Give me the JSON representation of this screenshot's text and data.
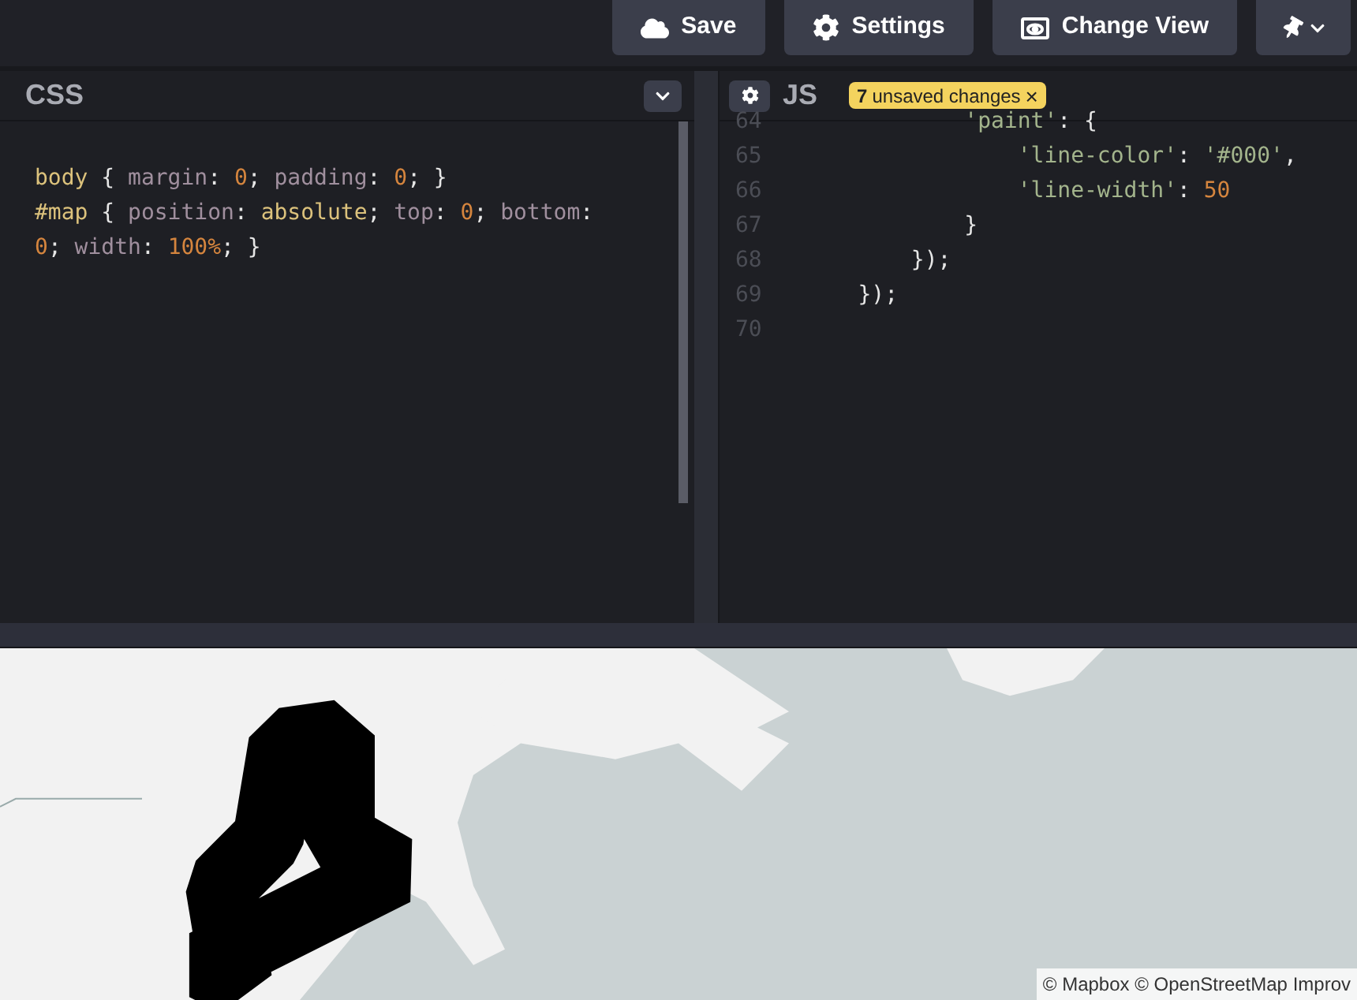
{
  "toolbar": {
    "buttons": [
      {
        "label": "Save",
        "kind": "cloud"
      },
      {
        "label": "Settings",
        "kind": "gear"
      },
      {
        "label": "Change View",
        "kind": "view"
      },
      {
        "kind": "pin"
      }
    ]
  },
  "css_panel": {
    "title": "CSS",
    "lines": [
      [
        {
          "kind": "sel",
          "t": "body"
        },
        {
          "kind": "punc",
          "t": " { "
        },
        {
          "kind": "prop",
          "t": "margin"
        },
        {
          "kind": "punc",
          "t": ": "
        },
        {
          "kind": "num",
          "t": "0"
        },
        {
          "kind": "punc",
          "t": "; "
        },
        {
          "kind": "prop",
          "t": "padding"
        },
        {
          "kind": "punc",
          "t": ": "
        },
        {
          "kind": "num",
          "t": "0"
        },
        {
          "kind": "punc",
          "t": "; }"
        }
      ],
      [
        {
          "kind": "sel",
          "t": "#map"
        },
        {
          "kind": "punc",
          "t": " { "
        },
        {
          "kind": "prop",
          "t": "position"
        },
        {
          "kind": "punc",
          "t": ": "
        },
        {
          "kind": "sel",
          "t": "absolute"
        },
        {
          "kind": "punc",
          "t": "; "
        },
        {
          "kind": "prop",
          "t": "top"
        },
        {
          "kind": "punc",
          "t": ": "
        },
        {
          "kind": "num",
          "t": "0"
        },
        {
          "kind": "punc",
          "t": "; "
        },
        {
          "kind": "prop",
          "t": "bottom"
        },
        {
          "kind": "punc",
          "t": ":"
        }
      ],
      [
        {
          "kind": "num",
          "t": "0"
        },
        {
          "kind": "punc",
          "t": "; "
        },
        {
          "kind": "prop",
          "t": "width"
        },
        {
          "kind": "punc",
          "t": ": "
        },
        {
          "kind": "num",
          "t": "100%"
        },
        {
          "kind": "punc",
          "t": "; }"
        }
      ]
    ]
  },
  "js_panel": {
    "title": "JS",
    "badge": {
      "count": "7",
      "text": "unsaved changes",
      "close": "×"
    },
    "lines": [
      {
        "number": "64",
        "tokens": [
          {
            "kind": "str",
            "t": "            'paint'"
          },
          {
            "kind": "punc",
            "t": ": {"
          }
        ]
      },
      {
        "number": "65",
        "tokens": [
          {
            "kind": "str",
            "t": "                'line-color'"
          },
          {
            "kind": "punc",
            "t": ": "
          },
          {
            "kind": "str",
            "t": "'#000'"
          },
          {
            "kind": "punc",
            "t": ","
          }
        ]
      },
      {
        "number": "66",
        "tokens": [
          {
            "kind": "str",
            "t": "                'line-width'"
          },
          {
            "kind": "punc",
            "t": ": "
          },
          {
            "kind": "num",
            "t": "50"
          }
        ]
      },
      {
        "number": "67",
        "tokens": [
          {
            "kind": "punc",
            "t": "            }"
          }
        ]
      },
      {
        "number": "68",
        "tokens": [
          {
            "kind": "punc",
            "t": "        });"
          }
        ]
      },
      {
        "number": "69",
        "tokens": [
          {
            "kind": "punc",
            "t": "    });"
          }
        ]
      },
      {
        "number": "70"
      }
    ]
  },
  "map": {
    "attribution": "© Mapbox © OpenStreetMap Improv"
  }
}
